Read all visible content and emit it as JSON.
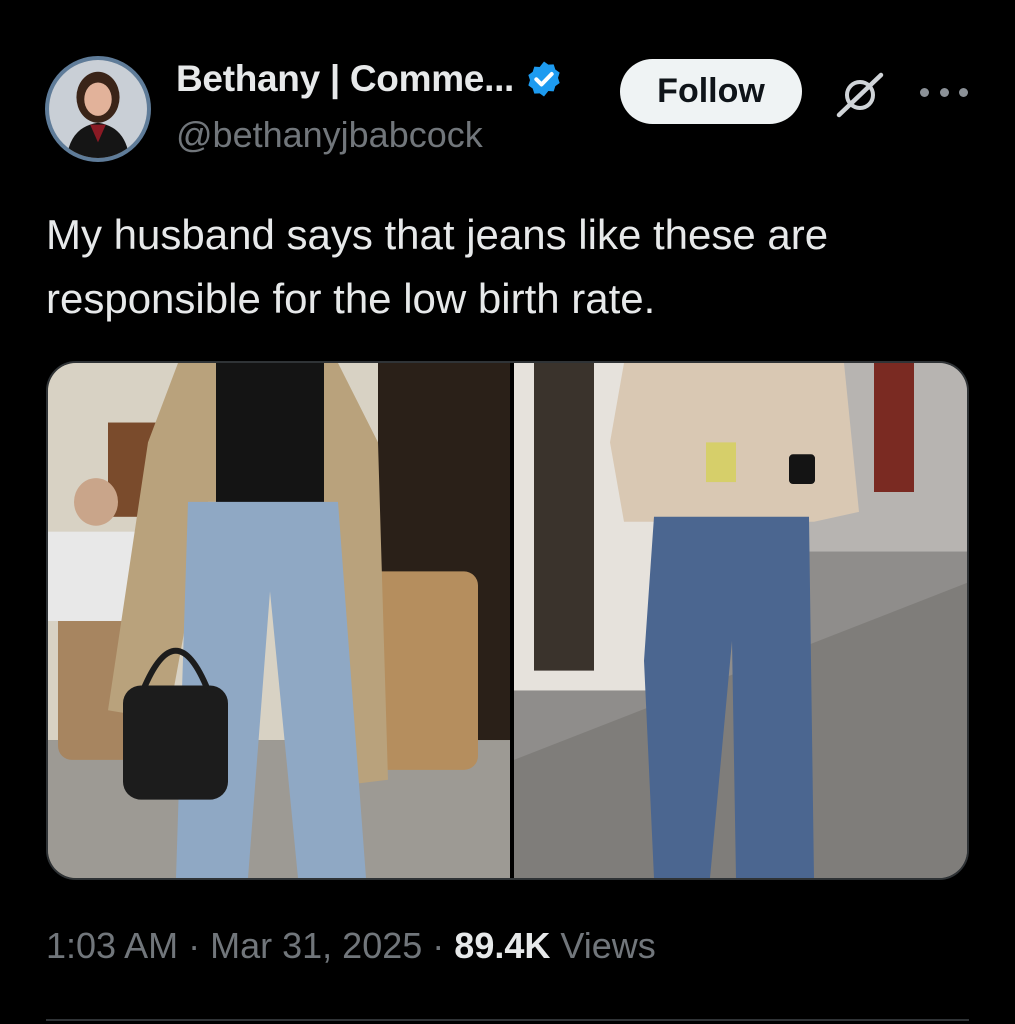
{
  "author": {
    "display_name": "Bethany | Comme...",
    "handle": "@bethanyjbabcock",
    "verified": true
  },
  "actions": {
    "follow_label": "Follow",
    "grok_icon": "grok-icon",
    "more_icon": "more-icon"
  },
  "tweet": {
    "text": "My husband says that jeans like these are\nresponsible for the low birth rate."
  },
  "meta": {
    "time": "1:03 AM",
    "date": "Mar 31, 2025",
    "views_count": "89.4K",
    "views_label": "Views",
    "separator": "·"
  },
  "colors": {
    "background": "#000000",
    "text_primary": "#e7e9ea",
    "text_secondary": "#71767b",
    "verified_blue": "#1d9bf0",
    "follow_bg": "#eff3f4"
  }
}
